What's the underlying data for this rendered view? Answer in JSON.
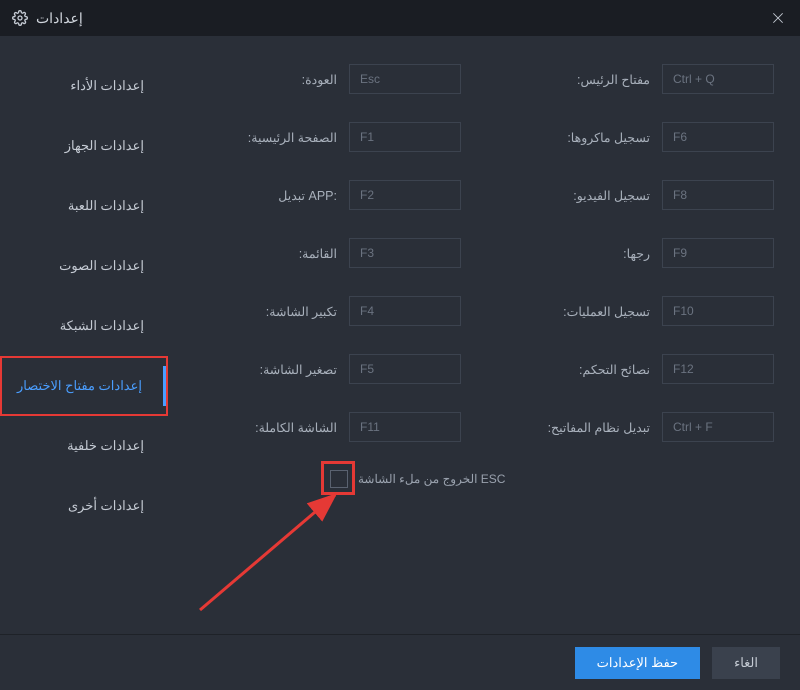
{
  "titlebar": {
    "title": "إعدادات"
  },
  "sidebar": {
    "items": [
      {
        "label": "إعدادات الأداء"
      },
      {
        "label": "إعدادات الجهاز"
      },
      {
        "label": "إعدادات اللعبة"
      },
      {
        "label": "إعدادات الصوت"
      },
      {
        "label": "إعدادات الشبكة"
      },
      {
        "label": "إعدادات مفتاح الاختصار"
      },
      {
        "label": "إعدادات خلفية"
      },
      {
        "label": "إعدادات أخرى"
      }
    ],
    "active_index": 5
  },
  "fields": {
    "left": [
      {
        "label": ":العودة",
        "value": "Esc"
      },
      {
        "label": ":الصفحة الرئيسية",
        "value": "F1"
      },
      {
        "label": "تبديل APP:",
        "value": "F2"
      },
      {
        "label": ":القائمة",
        "value": "F3"
      },
      {
        "label": ":تكبير الشاشة",
        "value": "F4"
      },
      {
        "label": ":تصغير الشاشة",
        "value": "F5"
      },
      {
        "label": ":الشاشة الكاملة",
        "value": "F11"
      }
    ],
    "right": [
      {
        "label": ":مفتاح الرئيس",
        "value": "Ctrl + Q"
      },
      {
        "label": ":تسجيل ماكروها",
        "value": "F6"
      },
      {
        "label": ":تسجيل الفيديو",
        "value": "F8"
      },
      {
        "label": ":رجها",
        "value": "F9"
      },
      {
        "label": ":تسجيل العمليات",
        "value": "F10"
      },
      {
        "label": ":نصائح التحكم",
        "value": "F12"
      },
      {
        "label": ":تبديل نظام المفاتيح",
        "value": "Ctrl + F"
      }
    ]
  },
  "checkbox": {
    "label": "الخروج من ملء الشاشة ESC"
  },
  "footer": {
    "save": "حفظ الإعدادات",
    "cancel": "الغاء"
  }
}
